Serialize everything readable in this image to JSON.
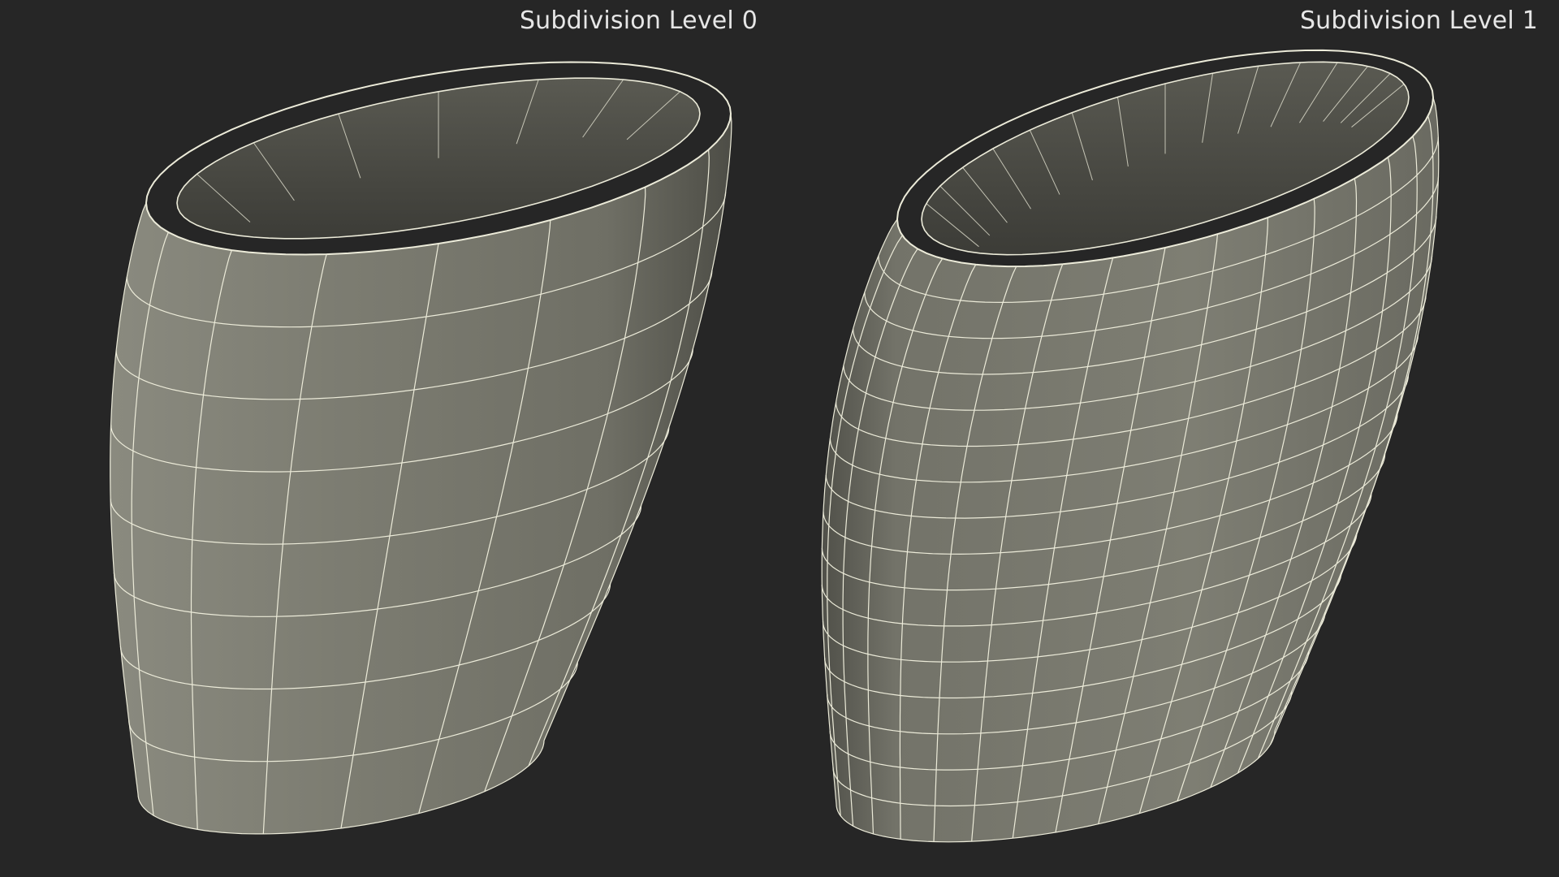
{
  "panels": [
    {
      "label": "Subdivision Level 0",
      "subdivision_level": 0
    },
    {
      "label": "Subdivision Level 1",
      "subdivision_level": 1
    }
  ],
  "colors": {
    "background": "#262626",
    "mesh_surface": "#7a7a70",
    "mesh_inner": "#4a4a44",
    "wire": "#ecebd9",
    "label_text": "#e6e6e6"
  }
}
